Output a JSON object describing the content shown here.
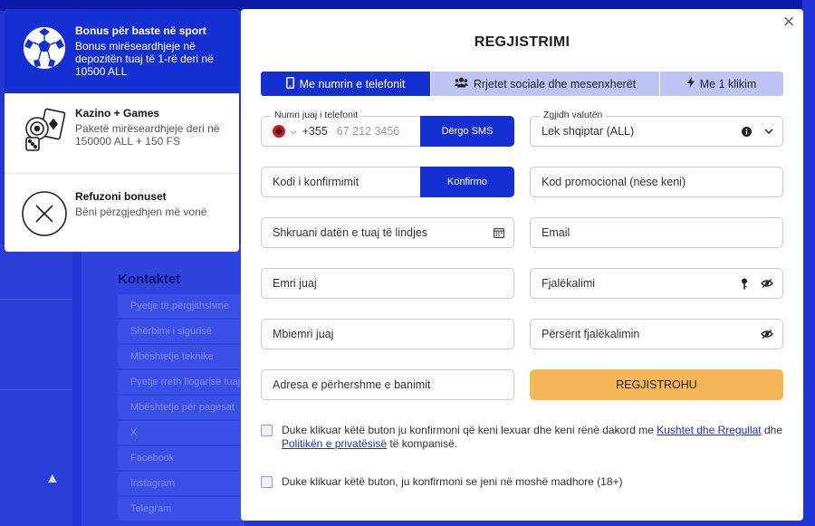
{
  "background": {
    "contacts_heading": "Kontaktet",
    "contacts_items": [
      "Pyetje të përgjithshme",
      "Shërbimi i sigurisë",
      "Mbështetje teknike",
      "Pyetje rreth llogarisë tuaj",
      "Mbështetje për pagesat",
      "X",
      "Facebook",
      "Instagram",
      "Telegram"
    ]
  },
  "bonus_panel": {
    "items": [
      {
        "icon": "soccer-ball-icon",
        "title": "Bonus për baste në sport",
        "description": "Bonus mirëseardhjeje në depozitën tuaj të 1-rë deri në 10500 ALL"
      },
      {
        "icon": "casino-chips-dice-icon",
        "title": "Kazino + Games",
        "description": "Paketë mirëseardhjeje deri në 150000 ALL + 150 FS"
      },
      {
        "icon": "cross-circle-icon",
        "title": "Refuzoni bonuset",
        "description": "Bëni përzgjedhjen më vonë"
      }
    ]
  },
  "modal": {
    "title": "REGJISTRIMI",
    "close_icon": "close-icon",
    "tabs": [
      {
        "icon": "phone-icon",
        "label": "Me numrin e telefonit",
        "active": true
      },
      {
        "icon": "users-icon",
        "label": "Rrjetet sociale dhe mesenxherët",
        "active": false
      },
      {
        "icon": "lightning-icon",
        "label": "Me 1 klikim",
        "active": false
      }
    ],
    "phone": {
      "label": "Numri juaj i telefonit",
      "country_code": "+355",
      "placeholder": "67 212 3456",
      "button": "Dërgo SMS"
    },
    "currency": {
      "label": "Zgjidh valutën",
      "value": "Lek shqiptar (ALL)"
    },
    "confirm_code": {
      "placeholder": "Kodi i konfirmimit",
      "button": "Konfirmo"
    },
    "promo_code": {
      "placeholder": "Kod promocional (nëse keni)"
    },
    "birthdate": {
      "placeholder": "Shkruani datën e tuaj të lindjes"
    },
    "email": {
      "placeholder": "Email"
    },
    "first_name": {
      "placeholder": "Emri juaj"
    },
    "password": {
      "placeholder": "Fjalëkalimi"
    },
    "last_name": {
      "placeholder": "Mbiemri juaj"
    },
    "repeat_password": {
      "placeholder": "Përsërit fjalëkalimin"
    },
    "address": {
      "placeholder": "Adresa e përhershme e banimit"
    },
    "register_button": "REGJISTROHU",
    "consent_terms": {
      "text_before": "Duke klikuar këtë buton ju konfirmoni që keni lexuar dhe keni rënë dakord me ",
      "link_terms": "Kushtet dhe Rregullat",
      "text_middle": " dhe ",
      "link_privacy": "Politikën e privatësisë",
      "text_after": " të kompanisë."
    },
    "consent_age": "Duke klikuar këtë buton, ju konfirmoni se jeni në moshë madhore (18+)"
  },
  "colors": {
    "primary": "#1530d2",
    "tab_inactive": "#bcc5f6",
    "register": "#f6b655",
    "link": "#1530d2"
  }
}
